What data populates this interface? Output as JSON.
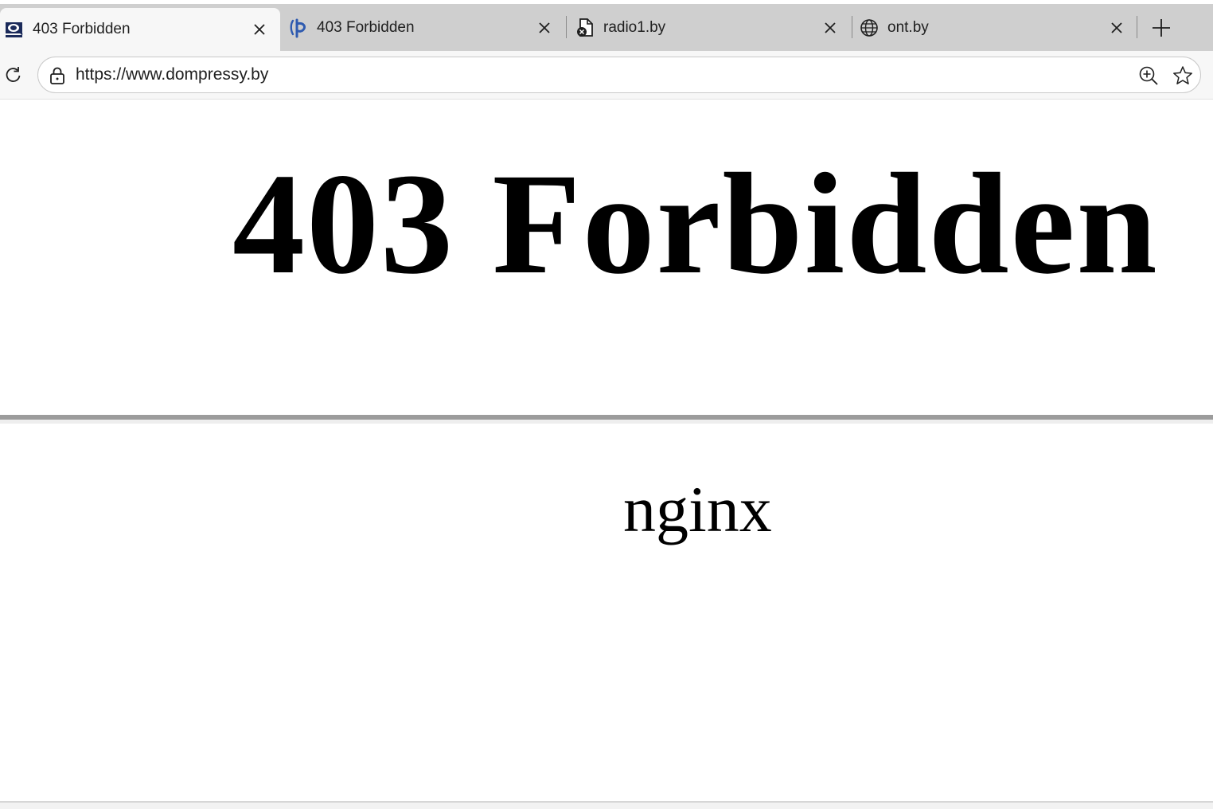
{
  "tabs": [
    {
      "title": "403 Forbidden",
      "favicon": "dompressy-logo-icon",
      "active": true
    },
    {
      "title": "403 Forbidden",
      "favicon": "blue-p-logo-icon",
      "active": false
    },
    {
      "title": "radio1.by",
      "favicon": "error-document-icon",
      "active": false
    },
    {
      "title": "ont.by",
      "favicon": "globe-icon",
      "active": false
    }
  ],
  "address_bar": {
    "url": "https://www.dompressy.by"
  },
  "page": {
    "heading": "403 Forbidden",
    "server": "nginx"
  },
  "colors": {
    "tabstrip_bg": "#cfcfcf",
    "active_tab_bg": "#f7f7f7",
    "toolbar_bg": "#f7f7f7",
    "text": "#1f1f1f",
    "page_text": "#000000",
    "rule": "#9c9c9c"
  }
}
